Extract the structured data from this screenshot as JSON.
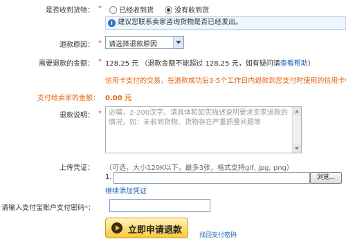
{
  "received": {
    "label": "是否收到货物：",
    "required": "*",
    "options": [
      "已经收到货",
      "没有收到货"
    ],
    "selected": 1,
    "tip": "建议您联系卖家咨询货物是否已经发出。"
  },
  "reason": {
    "label": "退款原因：",
    "required": "*",
    "placeholder_option": "请选择退款原因"
  },
  "amount": {
    "label": "需要退款的金额：",
    "required": "*",
    "value": "128.25 元",
    "note": "（退款金额不能超过  128.25 元，如有疑问请",
    "link": "查看帮助",
    "note_end": "）"
  },
  "credit_notice": "信用卡支付的交易，在退款成功后3-5个工作日内退款到您支付时使用的信用卡中",
  "pay_seller": {
    "label": "支付给卖家的金额：",
    "value": "0.00 元"
  },
  "explanation": {
    "label": "退款说明：",
    "required": "*",
    "placeholder": "必填，2-200汉字。请具体和如实描述说明要求卖家退款的情况，如：未收到货物、货物存在严重质量问题等"
  },
  "upload": {
    "label": "上传凭证：",
    "hint": "（可选，大小120K以下，最多3张，格式支持gif, jpg, png）",
    "index": "1.",
    "browse": "浏览...",
    "add_more": "继续添加凭证"
  },
  "password": {
    "label": "请输入支付宝账户支付密码",
    "required": "*",
    "colon": "："
  },
  "submit": {
    "label": "立即申请退款"
  },
  "retrieve_password": "找回支付密码",
  "colors": {
    "required": "#e03c14",
    "orange": "#e5630b",
    "link": "#1a5fb4",
    "button": "#f7c93d"
  }
}
